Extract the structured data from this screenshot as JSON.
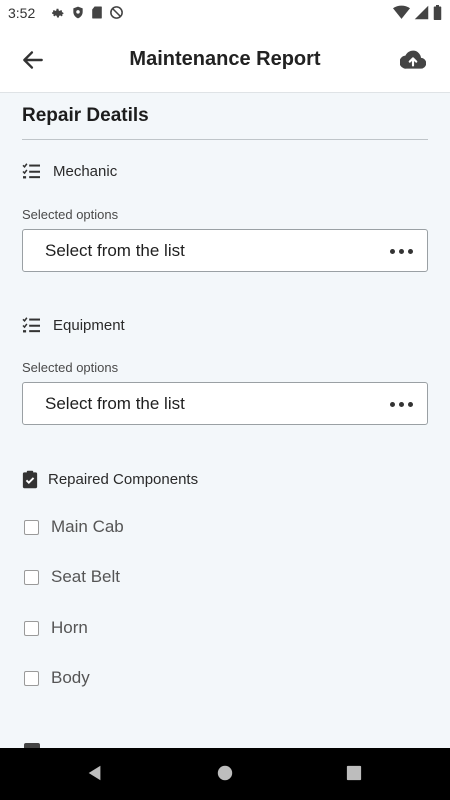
{
  "status_bar": {
    "time": "3:52",
    "left_icons": [
      "gear-icon",
      "shield-icon",
      "sdcard-icon",
      "at-icon"
    ],
    "right_icons": [
      "wifi-icon",
      "signal-icon",
      "battery-icon"
    ]
  },
  "app_bar": {
    "title": "Maintenance Report",
    "back_icon": "arrow-left-icon",
    "upload_icon": "cloud-upload-icon"
  },
  "section": {
    "title": "Repair Deatils"
  },
  "fields": [
    {
      "label": "Mechanic",
      "icon": "checklist-icon",
      "sub_label": "Selected options",
      "select_text": "Select from the list"
    },
    {
      "label": "Equipment",
      "icon": "checklist-icon",
      "sub_label": "Selected options",
      "select_text": "Select from the list"
    }
  ],
  "repaired_components": {
    "label": "Repaired Components",
    "icon": "clipboard-check-icon",
    "options": [
      {
        "label": "Main Cab",
        "checked": false
      },
      {
        "label": "Seat Belt",
        "checked": false
      },
      {
        "label": "Horn",
        "checked": false
      },
      {
        "label": "Body",
        "checked": false
      }
    ]
  },
  "nav_bar": {
    "icons": [
      "back-triangle-icon",
      "home-circle-icon",
      "recents-square-icon"
    ]
  },
  "colors": {
    "background": "#f3f7fa",
    "surface": "#ffffff",
    "nav_bar": "#000000",
    "border": "#9aa0a4"
  }
}
